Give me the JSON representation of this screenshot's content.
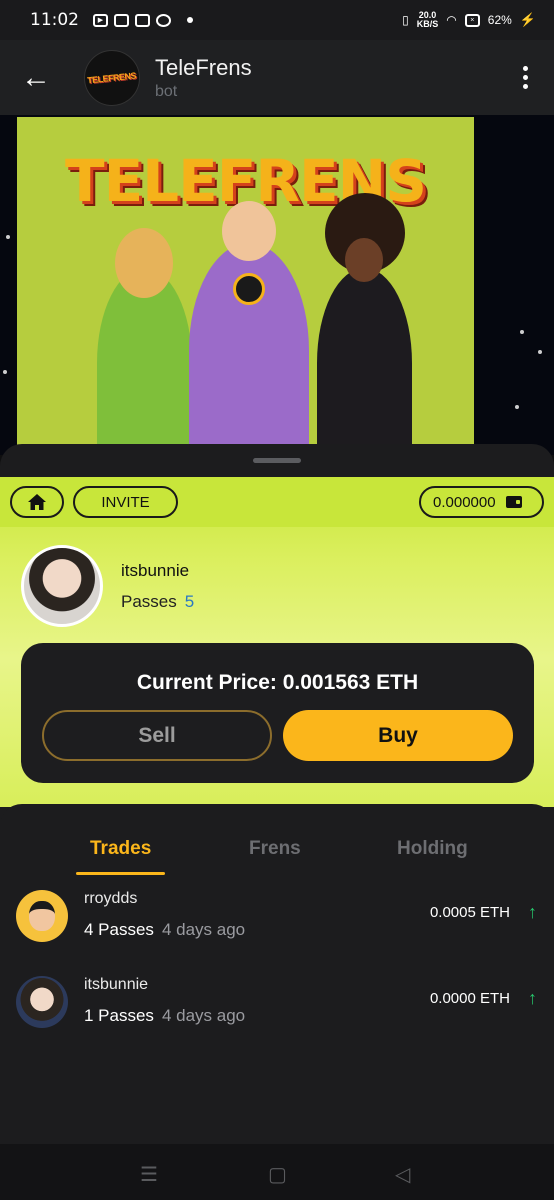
{
  "status": {
    "time": "11:02",
    "speed_top": "20.0",
    "speed_unit": "KB/S",
    "battery": "62%"
  },
  "header": {
    "title": "TeleFrens",
    "subtitle": "bot",
    "avatar_text": "TELEFRENS"
  },
  "banner": {
    "title": "TELEFRENS"
  },
  "toolbar": {
    "invite_label": "INVITE",
    "balance": "0.000000"
  },
  "profile": {
    "username": "itsbunnie",
    "passes_label": "Passes",
    "passes_count": "5"
  },
  "price_card": {
    "price_text": "Current Price: 0.001563 ETH",
    "sell_label": "Sell",
    "buy_label": "Buy"
  },
  "tabs": [
    {
      "label": "Trades"
    },
    {
      "label": "Frens"
    },
    {
      "label": "Holding"
    }
  ],
  "trades": [
    {
      "name": "rroydds",
      "passes": "4 Passes",
      "ago": "4 days ago",
      "amount": "0.0005 ETH"
    },
    {
      "name": "itsbunnie",
      "passes": "1 Passes",
      "ago": "4 days ago",
      "amount": "0.0000 ETH"
    }
  ],
  "colors": {
    "accent": "#fbb61b",
    "lime": "#c8e63a",
    "positive": "#27c46b",
    "link": "#2b78c2"
  }
}
